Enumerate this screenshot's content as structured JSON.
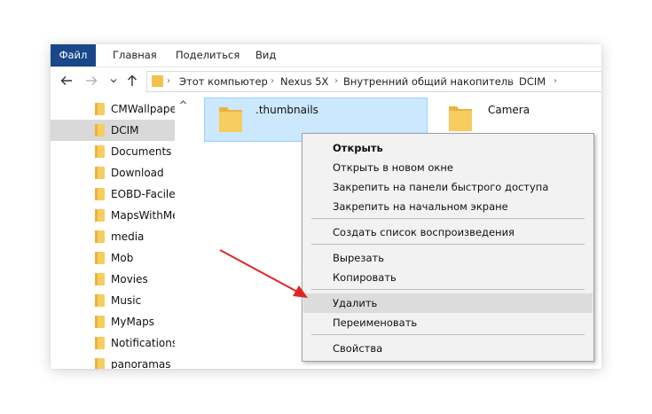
{
  "ribbon": {
    "tabs": [
      "Файл",
      "Главная",
      "Поделиться",
      "Вид"
    ]
  },
  "nav": {
    "back_icon": "back-arrow-icon",
    "forward_icon": "forward-arrow-icon",
    "recent_icon": "chevron-down-icon",
    "up_icon": "up-arrow-icon"
  },
  "breadcrumb": [
    "Этот компьютер",
    "Nexus 5X",
    "Внутренний общий накопитель",
    "DCIM"
  ],
  "sidebar": {
    "items": [
      {
        "label": "CMWallpapers"
      },
      {
        "label": "DCIM",
        "selected": true
      },
      {
        "label": "Documents"
      },
      {
        "label": "Download"
      },
      {
        "label": "EOBD-Facile"
      },
      {
        "label": "MapsWithMe"
      },
      {
        "label": "media"
      },
      {
        "label": "Mob"
      },
      {
        "label": "Movies"
      },
      {
        "label": "Music"
      },
      {
        "label": "MyMaps"
      },
      {
        "label": "Notifications"
      },
      {
        "label": "panoramas"
      }
    ]
  },
  "content": {
    "items": [
      {
        "label": ".thumbnails",
        "selected": true
      },
      {
        "label": "Camera",
        "selected": false
      }
    ]
  },
  "context_menu": {
    "items": [
      {
        "label": "Открыть",
        "bold": true
      },
      {
        "label": "Открыть в новом окне"
      },
      {
        "label": "Закрепить на панели быстрого доступа"
      },
      {
        "label": "Закрепить на начальном экране"
      },
      {
        "label": "Создать список воспроизведения"
      },
      {
        "label": "Вырезать"
      },
      {
        "label": "Копировать"
      },
      {
        "label": "Удалить",
        "highlighted": true
      },
      {
        "label": "Переименовать"
      },
      {
        "label": "Свойства"
      }
    ]
  },
  "colors": {
    "file_tab": "#19478a",
    "folder": "#f4c24e",
    "selection": "#cce8ff",
    "annotation_arrow": "#e02424"
  }
}
